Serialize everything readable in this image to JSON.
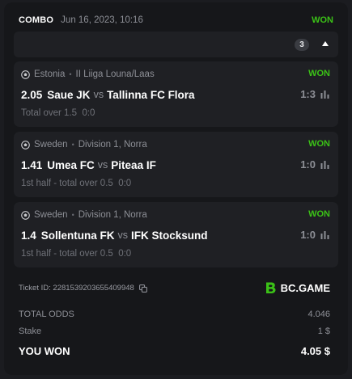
{
  "header": {
    "type": "COMBO",
    "date": "Jun 16, 2023, 10:16",
    "status": "WON"
  },
  "expander": {
    "count": "3"
  },
  "bets": [
    {
      "country": "Estonia",
      "league": "II Liiga Louna/Laas",
      "status": "WON",
      "odd": "2.05",
      "home": "Saue JK",
      "vs": "vs",
      "away": "Tallinna FC Flora",
      "score": "1:3",
      "market": "Total over 1.5",
      "result": "0:0"
    },
    {
      "country": "Sweden",
      "league": "Division 1, Norra",
      "status": "WON",
      "odd": "1.41",
      "home": "Umea FC",
      "vs": "vs",
      "away": "Piteaa IF",
      "score": "1:0",
      "market": "1st half - total over 0.5",
      "result": "0:0"
    },
    {
      "country": "Sweden",
      "league": "Division 1, Norra",
      "status": "WON",
      "odd": "1.4",
      "home": "Sollentuna FK",
      "vs": "vs",
      "away": "IFK Stocksund",
      "score": "1:0",
      "market": "1st half - total over 0.5",
      "result": "0:0"
    }
  ],
  "ticket": {
    "label": "Ticket ID:",
    "id": "2281539203655409948"
  },
  "brand": {
    "name": "BC.GAME"
  },
  "summary": {
    "total_odds_label": "TOTAL ODDS",
    "total_odds": "4.046",
    "stake_label": "Stake",
    "stake": "1 $",
    "won_label": "YOU WON",
    "won": "4.05 $"
  },
  "colors": {
    "accent": "#3bc117",
    "card": "#16171a",
    "panel": "#1f2024"
  }
}
